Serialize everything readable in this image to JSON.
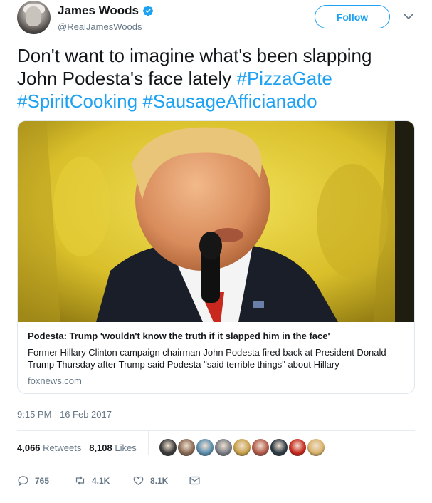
{
  "author": {
    "name": "James Woods",
    "handle": "@RealJamesWoods",
    "verified": true
  },
  "follow_label": "Follow",
  "tweet": {
    "text_line1": "Don't want to imagine what's been slapping",
    "text_line2_plain": "John Podesta's face lately ",
    "hashtags": [
      "#PizzaGate",
      "#SpiritCooking",
      "#SausageAfficianado"
    ]
  },
  "card": {
    "title": "Podesta: Trump 'wouldn't know the truth if it slapped him in the face'",
    "description": "Former Hillary Clinton campaign chairman John Podesta fired back at President Donald Trump Thursday after Trump said Podesta \"said terrible things\" about Hillary",
    "domain": "foxnews.com"
  },
  "timestamp": "9:15 PM - 16 Feb 2017",
  "stats": {
    "retweets_count": "4,066",
    "retweets_label": "Retweets",
    "likes_count": "8,108",
    "likes_label": "Likes"
  },
  "liker_avatars": [
    "#3a3a3a",
    "#8a6a55",
    "#5b8fb0",
    "#7a7f86",
    "#c9a24a",
    "#b25a4a",
    "#2d3a44",
    "#c8281d",
    "#d9b36a"
  ],
  "actions": {
    "reply_count": "765",
    "retweet_count": "4.1K",
    "like_count": "8.1K"
  },
  "colors": {
    "accent": "#1da1f2",
    "muted": "#657786",
    "text": "#14171a"
  }
}
